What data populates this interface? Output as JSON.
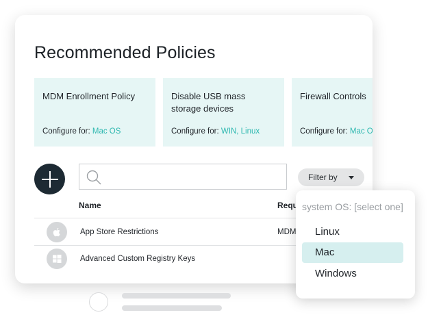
{
  "page": {
    "title": "Recommended Policies"
  },
  "policies": [
    {
      "name": "MDM Enrollment Policy",
      "configure_label": "Configure for:",
      "os": "Mac OS"
    },
    {
      "name": "Disable USB mass storage devices",
      "configure_label": "Configure for:",
      "os": "WIN, Linux"
    },
    {
      "name": "Firewall Controls",
      "configure_label": "Configure for:",
      "os": "Mac OS, WIN"
    }
  ],
  "search": {
    "placeholder": ""
  },
  "filter": {
    "label": "Filter by"
  },
  "table": {
    "headers": {
      "name": "Name",
      "requirement": "Requ"
    },
    "rows": [
      {
        "icon": "apple-icon",
        "name": "App Store Restrictions",
        "requirement": "MDM"
      },
      {
        "icon": "windows-icon",
        "name": "Advanced Custom Registry Keys",
        "requirement": ""
      }
    ]
  },
  "dropdown": {
    "heading": "system OS: [select one]",
    "options": [
      "Linux",
      "Mac",
      "Windows"
    ],
    "selected": "Mac"
  },
  "colors": {
    "accent": "#2fb8b0",
    "card_bg": "#e6f6f5",
    "selected_bg": "#d6efef",
    "add_button": "#1d2a33"
  }
}
